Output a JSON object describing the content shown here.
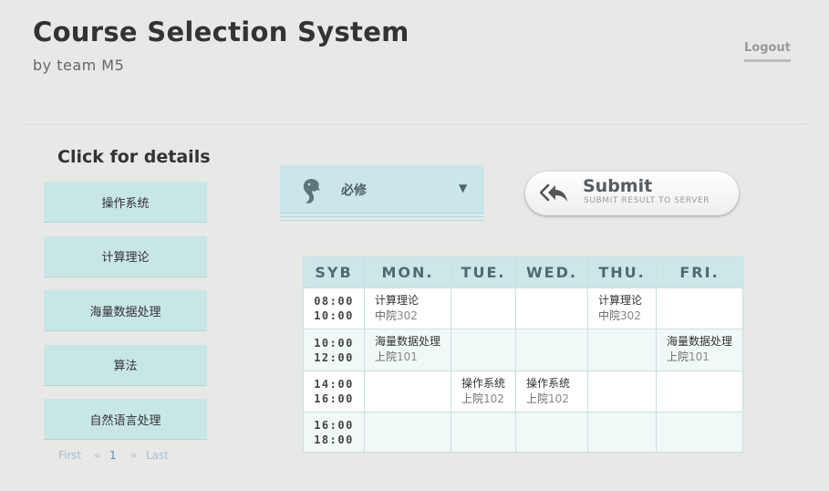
{
  "header": {
    "title": "Course Selection System",
    "subtitle": "by team M5",
    "logout_label": "Logout"
  },
  "sidebar": {
    "heading": "Click for details",
    "courses": [
      "操作系统",
      "计算理论",
      "海量数据处理",
      "算法",
      "自然语言处理"
    ],
    "pagination": {
      "first": "First",
      "prev": "«",
      "current": "1",
      "next": "»",
      "last": "Last"
    }
  },
  "filter": {
    "selected": "必修",
    "caret": "▼",
    "icon": "seahorse-icon"
  },
  "submit": {
    "label": "Submit",
    "sublabel": "SUBMIT RESULT TO SERVER",
    "icon": "reply-all-icon"
  },
  "schedule": {
    "headers": [
      "SYB",
      "MON.",
      "TUE.",
      "WED.",
      "THU.",
      "FRI."
    ],
    "rows": [
      {
        "time_start": "08:00",
        "time_end": "10:00",
        "cells": [
          {
            "course": "计算理论",
            "building": "中院",
            "room": "302"
          },
          null,
          null,
          {
            "course": "计算理论",
            "building": "中院",
            "room": "302"
          },
          null
        ]
      },
      {
        "time_start": "10:00",
        "time_end": "12:00",
        "cells": [
          {
            "course": "海量数据处理",
            "building": "上院",
            "room": "101"
          },
          null,
          null,
          null,
          {
            "course": "海量数据处理",
            "building": "上院",
            "room": "101"
          }
        ]
      },
      {
        "time_start": "14:00",
        "time_end": "16:00",
        "cells": [
          null,
          {
            "course": "操作系统",
            "building": "上院",
            "room": "102"
          },
          {
            "course": "操作系统",
            "building": "上院",
            "room": "102"
          },
          null,
          null
        ]
      },
      {
        "time_start": "16:00",
        "time_end": "18:00",
        "cells": [
          null,
          null,
          null,
          null,
          null
        ]
      }
    ]
  },
  "colors": {
    "background": "#e8e8e6",
    "accent_teal": "#c9e6e7",
    "header_text": "#4e6b74",
    "link_blue": "#5a8fb8"
  }
}
